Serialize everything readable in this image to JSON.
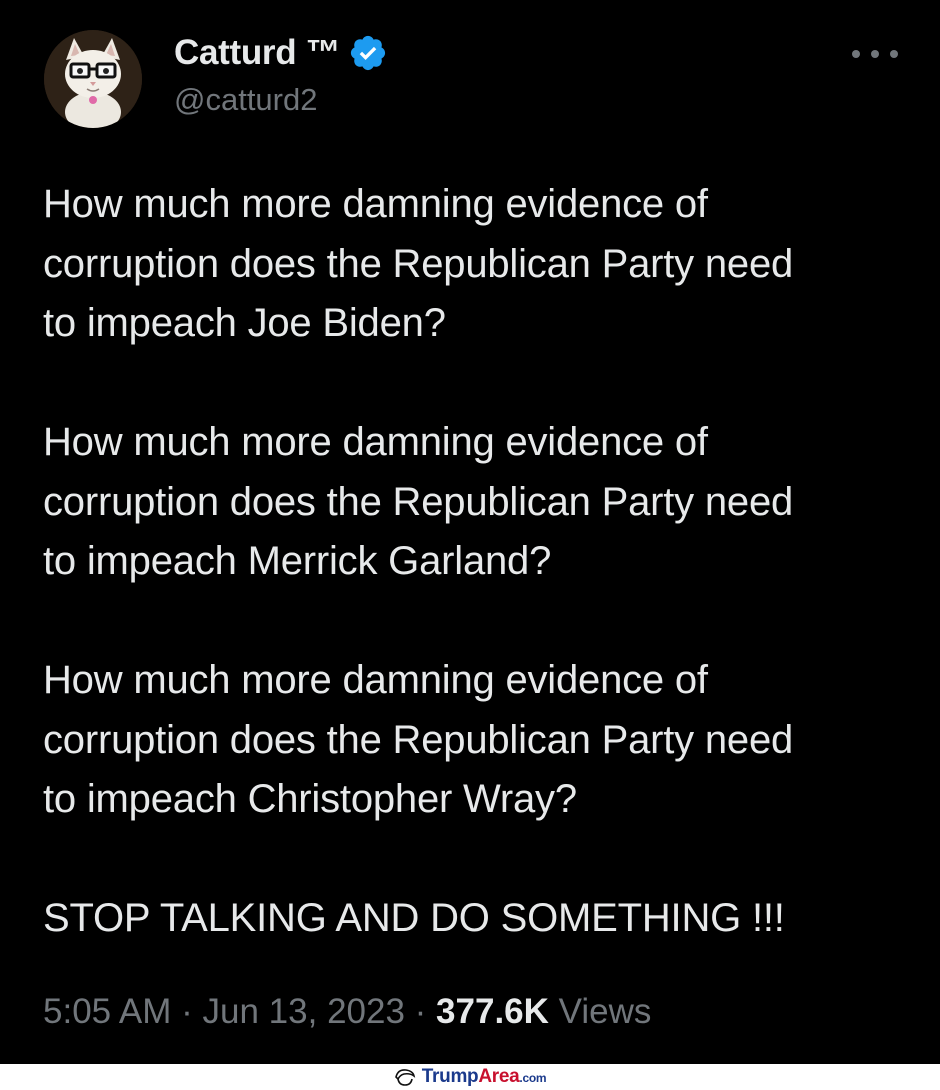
{
  "author": {
    "display_name": "Catturd ™",
    "handle": "@catturd2",
    "verified": true
  },
  "tweet": {
    "paragraphs": [
      "How much more damning evidence of\ncorruption does the Republican Party need\nto impeach Joe Biden?",
      "How much more damning evidence of\ncorruption does the Republican Party need\nto impeach Merrick Garland?",
      "How much more damning evidence of\ncorruption does the Republican Party need\nto impeach Christopher Wray?",
      "STOP TALKING AND DO SOMETHING !!!"
    ]
  },
  "meta": {
    "time": "5:05 AM",
    "separator": " · ",
    "date": "Jun 13, 2023",
    "views_count": "377.6K",
    "views_label": "Views"
  },
  "watermark": {
    "part1": "Trump",
    "part2": "Area",
    "part3": ".com"
  },
  "icons": {
    "verified": "verified-badge-icon",
    "more": "more-options-icon"
  },
  "colors": {
    "background": "#000000",
    "primary_text": "#e7e9ea",
    "secondary_text": "#71767b",
    "verified_blue": "#1d9bf0"
  }
}
